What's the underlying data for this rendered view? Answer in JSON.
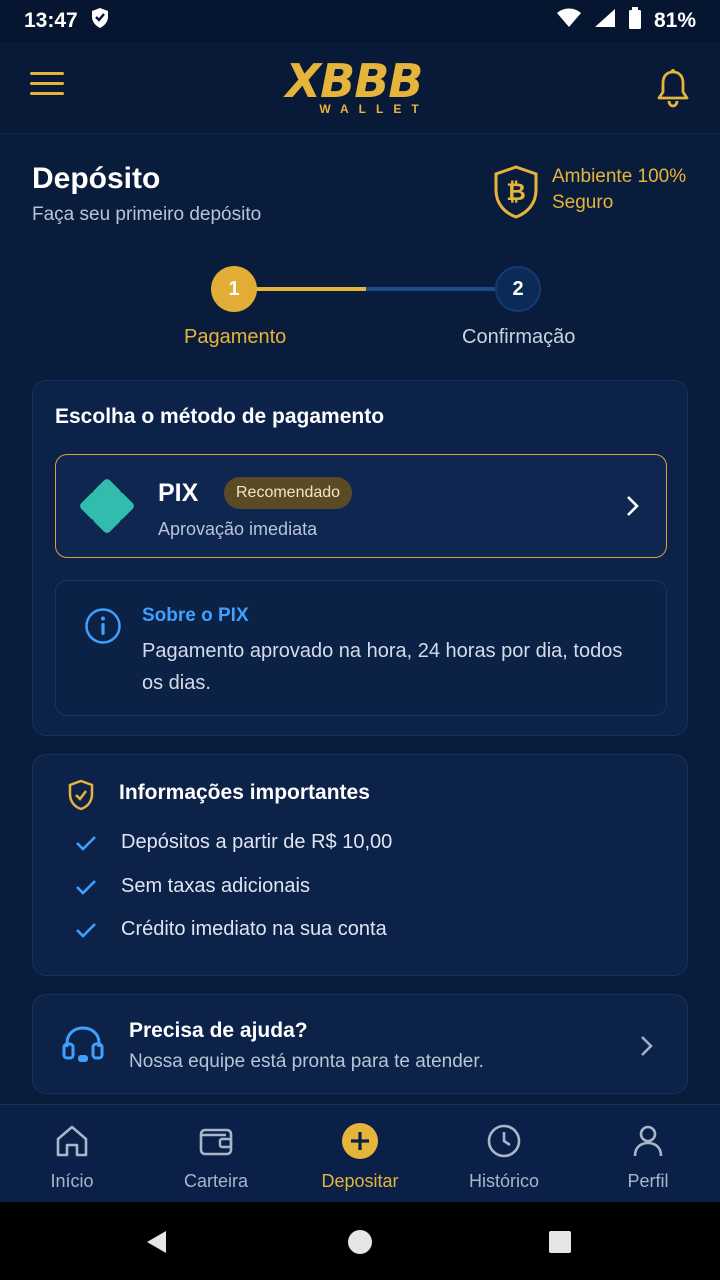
{
  "status_bar": {
    "time": "13:47",
    "battery": "81%"
  },
  "app": {
    "logo_main": "XBBB",
    "logo_sub": "WALLET"
  },
  "page": {
    "title": "Depósito",
    "subtitle": "Faça seu primeiro depósito",
    "secure_label": "Ambiente 100% Seguro"
  },
  "stepper": {
    "steps": [
      {
        "number": "1",
        "label": "Pagamento"
      },
      {
        "number": "2",
        "label": "Confirmação"
      }
    ]
  },
  "payment": {
    "title": "Escolha o método de pagamento",
    "method": {
      "name": "PIX",
      "badge": "Recomendado",
      "description": "Aprovação imediata"
    },
    "info": {
      "title": "Sobre o PIX",
      "text": "Pagamento aprovado na hora, 24 horas por dia, todos os dias."
    }
  },
  "important": {
    "title": "Informações importantes",
    "items": [
      "Depósitos a partir de R$ 10,00",
      "Sem taxas adicionais",
      "Crédito imediato na sua conta"
    ]
  },
  "help": {
    "title": "Precisa de ajuda?",
    "subtitle": "Nossa equipe está pronta para te atender."
  },
  "bottom_nav": {
    "items": [
      {
        "label": "Início",
        "icon": "home-icon"
      },
      {
        "label": "Carteira",
        "icon": "wallet-icon"
      },
      {
        "label": "Depositar",
        "icon": "plus-circle-icon",
        "active": true
      },
      {
        "label": "Histórico",
        "icon": "clock-icon"
      },
      {
        "label": "Perfil",
        "icon": "user-icon"
      }
    ]
  },
  "colors": {
    "background": "#0a1c3c",
    "accent_gold": "#e5b43b",
    "pix_teal": "#32bcad",
    "info_blue": "#3ea0ff"
  }
}
